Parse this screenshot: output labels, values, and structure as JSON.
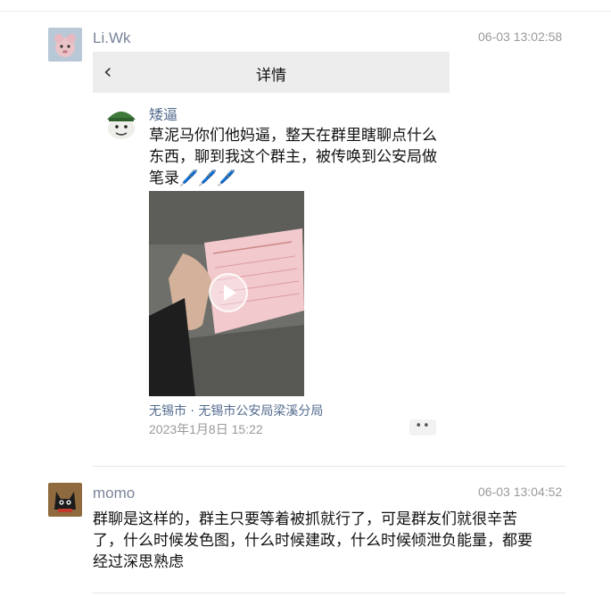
{
  "comments": [
    {
      "username": "Li.Wk",
      "time": "06-03 13:02:58",
      "avatar_icon": "pink-cartoon-avatar",
      "screenshot": {
        "header_title": "详情",
        "back_icon": "‹",
        "post_author": "矮逼",
        "post_text": "草泥马你们他妈逼，整天在群里瞎聊点什么东西，聊到我这个群主，被传唤到公安局做笔录🖊️🖊️🖊️",
        "location": "无锡市 · 无锡市公安局梁溪分局",
        "date": "2023年1月8日 15:22",
        "more_label": "••"
      }
    },
    {
      "username": "momo",
      "time": "06-03 13:04:52",
      "avatar_icon": "black-cat-avatar",
      "text": "群聊是这样的，群主只要等着被抓就行了，可是群友们就很辛苦了，什么时候发色图，什么时候建政，什么时候倾泄负能量，都要经过深思熟虑"
    }
  ]
}
